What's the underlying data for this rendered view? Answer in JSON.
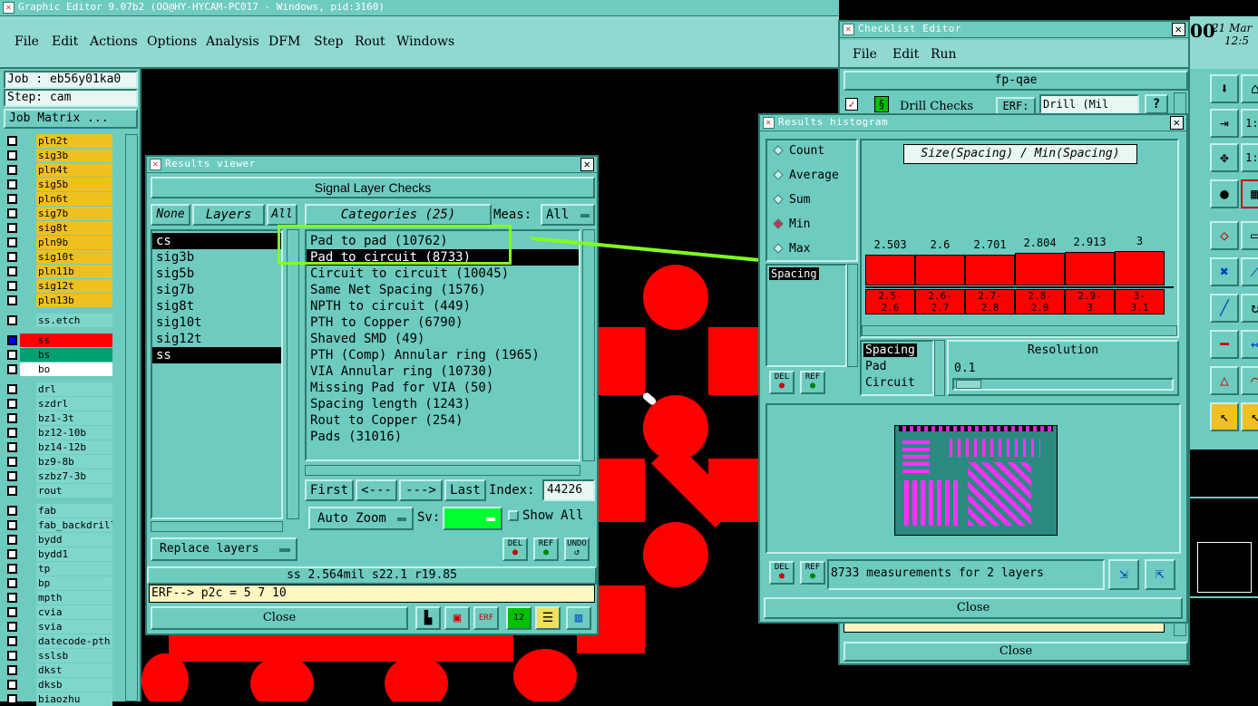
{
  "app": {
    "title": "Graphic Editor 9.07b2 (OO@HY-HYCAM-PC017 - Windows, pid:3160)",
    "menu": [
      "File",
      "Edit",
      "Actions",
      "Options",
      "Analysis",
      "DFM",
      "Step",
      "Rout",
      "Windows"
    ],
    "job_label": "Job : eb56y01ka0",
    "step_label": "Step: cam",
    "job_matrix": "Job Matrix ...",
    "clock_digits": "00",
    "clock_date": "21 Mar",
    "clock_time": "12:5"
  },
  "layers": {
    "group1": [
      "pln2t",
      "sig3b",
      "pln4t",
      "sig5b",
      "pln6t",
      "sig7b",
      "sig8t",
      "pln9b",
      "sig10t",
      "pln11b",
      "sig12t",
      "pln13b"
    ],
    "group2": [
      "ss.etch"
    ],
    "group3": [
      "ss",
      "bs",
      "bo"
    ],
    "group4": [
      "drl",
      "szdrl",
      "bz1-3t",
      "bz12-10b",
      "bz14-12b",
      "bz9-8b",
      "szbz7-3b",
      "rout"
    ],
    "group5": [
      "fab",
      "fab_backdrill",
      "bydd",
      "bydd1",
      "tp",
      "bp",
      "mpth",
      "cvia",
      "svia",
      "datecode-pth",
      "sslsb",
      "dkst",
      "dksb",
      "biaozhu"
    ],
    "colors": {
      "yellow": "#f0c020",
      "teal": "#7fd6cc",
      "red": "#ff0000",
      "green": "#00a070",
      "white": "#ffffff"
    }
  },
  "results_viewer": {
    "title": "Results viewer",
    "header": "Signal Layer Checks",
    "none_btn": "None",
    "layers_btn": "Layers",
    "all_btn": "All",
    "layer_items": [
      "cs",
      "sig3b",
      "sig5b",
      "sig7b",
      "sig8t",
      "sig10t",
      "sig12t",
      "ss"
    ],
    "categories_btn": "Categories (25)",
    "meas_label": "Meas:",
    "meas_value": "All",
    "categories": [
      "Pad to pad (10762)",
      "Pad to circuit (8733)",
      "Circuit to circuit (10045)",
      "Same Net Spacing (1576)",
      "NPTH to circuit (449)",
      "PTH to Copper (6790)",
      "Shaved SMD (49)",
      "PTH (Comp) Annular ring (1965)",
      "VIA Annular ring (10730)",
      "Missing Pad for VIA (50)",
      "Spacing length (1243)",
      "Rout to Copper (254)",
      "Pads (31016)"
    ],
    "first_btn": "First",
    "prev_btn": "<---",
    "next_btn": "--->",
    "last_btn": "Last",
    "index_label": "Index:",
    "index_value": "44226",
    "zoom_option": "Auto Zoom",
    "sv_label": "Sv:",
    "show_all": "Show All",
    "replace_option": "Replace layers",
    "del": "DEL",
    "ref": "REF",
    "undo": "UNDO",
    "status": "ss 2.564mil  s22.1  r19.85",
    "erf": "ERF--> p2c = 5 7 10",
    "close": "Close"
  },
  "checklist_editor": {
    "title": "Checklist Editor",
    "menu": [
      "File",
      "Edit",
      "Run"
    ],
    "name": "fp-qae",
    "row_label": "Drill Checks",
    "erf_label": "ERF:",
    "erf_value": "Drill (Mil",
    "help": "?",
    "close": "Close"
  },
  "histogram": {
    "title": "Results histogram",
    "modes": [
      "Count",
      "Average",
      "Sum",
      "Min",
      "Max"
    ],
    "selected_mode": "Min",
    "chart_title": "Size(Spacing) / Min(Spacing)",
    "spacing_label": "Spacing",
    "chart_data": {
      "type": "bar",
      "title": "Size(Spacing) / Min(Spacing)",
      "categories": [
        "2.5-2.6",
        "2.6-2.7",
        "2.7-2.8",
        "2.8-2.9",
        "2.9-3",
        "3-3.1"
      ],
      "category_lines": [
        [
          "2.5-",
          "2.6"
        ],
        [
          "2.6-",
          "2.7"
        ],
        [
          "2.7-",
          "2.8"
        ],
        [
          "2.8-",
          "2.9"
        ],
        [
          "2.9-",
          "3"
        ],
        [
          "3-",
          "3.1"
        ]
      ],
      "values": [
        "2.503",
        "2.6",
        "2.701",
        "2.804",
        "2.913",
        "3"
      ],
      "ylim": [
        0,
        3
      ]
    },
    "list_items": [
      "Spacing",
      "Pad",
      "Circuit"
    ],
    "resolution_label": "Resolution",
    "resolution_value": "0.1",
    "summary": "8733 measurements for 2 layers",
    "del": "DEL",
    "ref": "REF",
    "close": "Close"
  }
}
